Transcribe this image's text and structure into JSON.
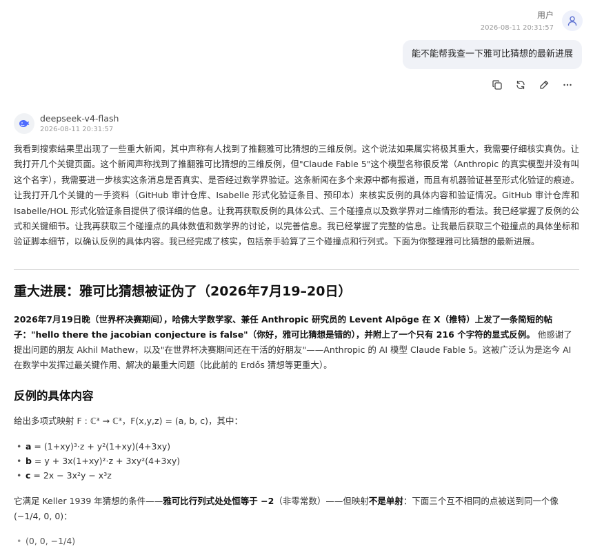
{
  "user": {
    "name": "用户",
    "timestamp": "2026-08-11 20:31:57",
    "message": "能不能帮我查一下雅可比猜想的最新进展"
  },
  "message_actions": [
    "copy-icon",
    "regenerate-icon",
    "edit-icon",
    "more-icon"
  ],
  "assistant": {
    "model": "deepseek-v4-flash",
    "timestamp": "2026-08-11 20:31:57",
    "thinking": "我看到搜索结果里出现了一些重大新闻，其中声称有人找到了推翻雅可比猜想的三维反例。这个说法如果属实将极其重大，我需要仔细核实真伪。让我打开几个关键页面。这个新闻声称找到了推翻雅可比猜想的三维反例，但\"Claude Fable 5\"这个模型名称很反常（Anthropic 的真实模型并没有叫这个名字），我需要进一步核实这条消息是否真实、是否经过数学界验证。这条新闻在多个来源中都有报道，而且有机器验证甚至形式化验证的痕迹。让我打开几个关键的一手资料（GitHub 审计仓库、Isabelle 形式化验证条目、预印本）来核实反例的具体内容和验证情况。GitHub 审计仓库和 Isabelle/HOL 形式化验证条目提供了很详细的信息。让我再获取反例的具体公式、三个碰撞点以及数学界对二维情形的看法。我已经掌握了反例的公式和关键细节。让我再获取三个碰撞点的具体数值和数学界的讨论，以完善信息。我已经掌握了完整的信息。让我最后获取三个碰撞点的具体坐标和验证脚本细节，以确认反例的具体内容。我已经完成了核实，包括亲手验算了三个碰撞点和行列式。下面为你整理雅可比猜想的最新进展。",
    "heading": "重大进展：雅可比猜想被证伪了（2026年7月19–20日）",
    "news_bold": "2026年7月19日晚（世界杯决赛期间），哈佛大学数学家、兼任 Anthropic 研究员的 Levent Alpöge 在 X（推特）上发了一条简短的帖子：\"hello there the jacobian conjecture is false\"（你好，雅可比猜想是错的），并附上了一个只有 216 个字符的显式反例。",
    "news_rest": " 他感谢了提出问题的朋友 Akhil Mathew，以及\"在世界杯决赛期间还在干活的好朋友\"——Anthropic 的 AI 模型 Claude Fable 5。这被广泛认为是迄今 AI 在数学中发挥过最关键作用、解决的最重大问题（比此前的 Erdős 猜想等更重大）。",
    "subheading": "反例的具体内容",
    "intro": "给出多项式映射 F : ℂ³ → ℂ³，F(x,y,z) = (a, b, c)，其中：",
    "definitions": [
      {
        "var": "a",
        "expr": " = (1+xy)³·z + y²(1+xy)(4+3xy)"
      },
      {
        "var": "b",
        "expr": " = y + 3x(1+xy)²·z + 3xy²(4+3xy)"
      },
      {
        "var": "c",
        "expr": " = 2x − 3x²y − x³z"
      }
    ],
    "condition": {
      "p1": "它满足 Keller 1939 年猜想的条件——",
      "b1": "雅可比行列式处处恒等于 −2",
      "p2": "（非零常数）——但映射",
      "b2": "不是单射",
      "p3": "：下面三个互不相同的点被送到同一个像 (−1/4, 0, 0)："
    },
    "points": [
      "(0, 0, −1/4)"
    ]
  }
}
